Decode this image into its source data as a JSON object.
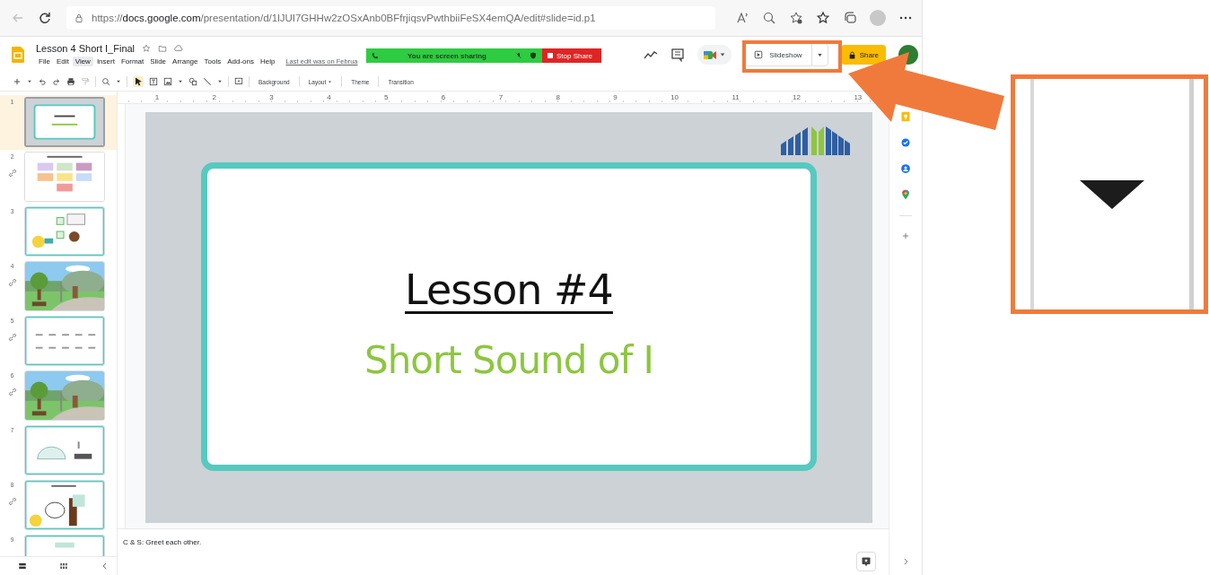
{
  "browser": {
    "url_scheme": "https://",
    "url_domain": "docs.google.com",
    "url_path": "/presentation/d/1lJUI7GHHw2zOSxAnb0BFfrjiqsvPwthbiiFeSX4emQA/edit#slide=id.p1"
  },
  "document": {
    "title": "Lesson 4 Short I_Final",
    "last_edit": "Last edit was on Februa"
  },
  "menu": [
    {
      "label": "File",
      "selected": false
    },
    {
      "label": "Edit",
      "selected": false
    },
    {
      "label": "View",
      "selected": true
    },
    {
      "label": "Insert",
      "selected": false
    },
    {
      "label": "Format",
      "selected": false
    },
    {
      "label": "Slide",
      "selected": false
    },
    {
      "label": "Arrange",
      "selected": false
    },
    {
      "label": "Tools",
      "selected": false
    },
    {
      "label": "Add-ons",
      "selected": false
    },
    {
      "label": "Help",
      "selected": false
    }
  ],
  "screen_share": {
    "message": "You are screen sharing",
    "stop_label": "Stop Share"
  },
  "header_buttons": {
    "slideshow": "Slideshow",
    "share": "Share"
  },
  "toolbar": {
    "buttons": [
      "Background",
      "Layout",
      "Theme",
      "Transition"
    ]
  },
  "ruler": {
    "ticks": [
      "1",
      "2",
      "3",
      "4",
      "5",
      "6",
      "7",
      "8",
      "9",
      "10",
      "11",
      "12",
      "13"
    ]
  },
  "filmstrip": [
    {
      "number": "1",
      "selected": true,
      "linked": false,
      "kind": "title"
    },
    {
      "number": "2",
      "selected": false,
      "linked": true,
      "kind": "grid"
    },
    {
      "number": "3",
      "selected": false,
      "linked": false,
      "kind": "checklist"
    },
    {
      "number": "4",
      "selected": false,
      "linked": true,
      "kind": "picture"
    },
    {
      "number": "5",
      "selected": false,
      "linked": true,
      "kind": "letters"
    },
    {
      "number": "6",
      "selected": false,
      "linked": true,
      "kind": "picture"
    },
    {
      "number": "7",
      "selected": false,
      "linked": false,
      "kind": "igloo"
    },
    {
      "number": "8",
      "selected": false,
      "linked": true,
      "kind": "chop"
    },
    {
      "number": "9",
      "selected": false,
      "linked": false,
      "kind": "partial"
    }
  ],
  "slide": {
    "title": "Lesson #4",
    "subtitle": "Short Sound of I"
  },
  "notes": "C & S: Greet each other."
}
